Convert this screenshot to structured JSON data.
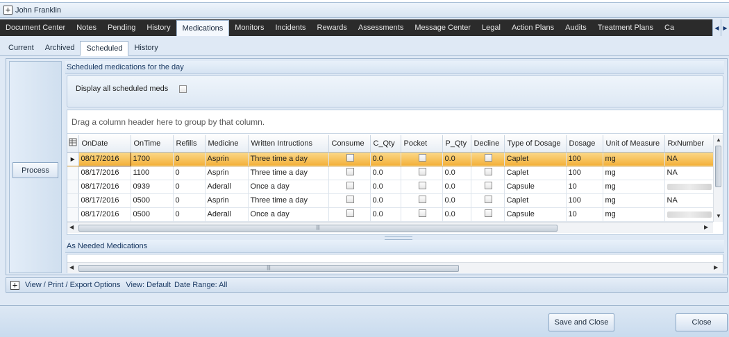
{
  "patient": {
    "expand_icon": "plus-icon",
    "name": "John Franklin"
  },
  "main_tabs": [
    "Document Center",
    "Notes",
    "Pending",
    "History",
    "Medications",
    "Monitors",
    "Incidents",
    "Rewards",
    "Assessments",
    "Message Center",
    "Legal",
    "Action Plans",
    "Audits",
    "Treatment Plans",
    "Ca"
  ],
  "main_tabs_active": "Medications",
  "sub_tabs": [
    "Current",
    "Archived",
    "Scheduled",
    "History"
  ],
  "sub_tabs_active": "Scheduled",
  "process_label": "Process",
  "scheduled": {
    "title": "Scheduled medications for the day",
    "filter_label": "Display all scheduled meds",
    "group_hint": "Drag a column header here to group by that column.",
    "columns": [
      "OnDate",
      "OnTime",
      "Refills",
      "Medicine",
      "Written Intructions",
      "Consume",
      "C_Qty",
      "Pocket",
      "P_Qty",
      "Decline",
      "Type of Dosage",
      "Dosage",
      "Unit of Measure",
      "RxNumber"
    ],
    "rows": [
      {
        "OnDate": "08/17/2016",
        "OnTime": "1700",
        "Refills": "0",
        "Medicine": "Asprin",
        "Instructions": "Three time a day",
        "C_Qty": "0.0",
        "P_Qty": "0.0",
        "Type": "Caplet",
        "Dosage": "100",
        "Unit": "mg",
        "Rx": "NA",
        "selected": true
      },
      {
        "OnDate": "08/17/2016",
        "OnTime": "1100",
        "Refills": "0",
        "Medicine": "Asprin",
        "Instructions": "Three time a day",
        "C_Qty": "0.0",
        "P_Qty": "0.0",
        "Type": "Caplet",
        "Dosage": "100",
        "Unit": "mg",
        "Rx": "NA"
      },
      {
        "OnDate": "08/17/2016",
        "OnTime": "0939",
        "Refills": "0",
        "Medicine": "Aderall",
        "Instructions": "Once a day",
        "C_Qty": "0.0",
        "P_Qty": "0.0",
        "Type": "Capsule",
        "Dosage": "10",
        "Unit": "mg",
        "Rx": ""
      },
      {
        "OnDate": "08/17/2016",
        "OnTime": "0500",
        "Refills": "0",
        "Medicine": "Asprin",
        "Instructions": "Three time a day",
        "C_Qty": "0.0",
        "P_Qty": "0.0",
        "Type": "Caplet",
        "Dosage": "100",
        "Unit": "mg",
        "Rx": "NA"
      },
      {
        "OnDate": "08/17/2016",
        "OnTime": "0500",
        "Refills": "0",
        "Medicine": "Aderall",
        "Instructions": "Once a day",
        "C_Qty": "0.0",
        "P_Qty": "0.0",
        "Type": "Capsule",
        "Dosage": "10",
        "Unit": "mg",
        "Rx": ""
      }
    ]
  },
  "as_needed": {
    "title": "As Needed Medications"
  },
  "options": {
    "label": "View / Print / Export Options",
    "view": "View: Default",
    "range": "Date Range: All"
  },
  "footer": {
    "save_close": "Save and Close",
    "close": "Close"
  },
  "colors": {
    "selected_row": "#f3b13b",
    "tab_bar": "#2b2b2b",
    "frame": "#dfe9f5"
  }
}
